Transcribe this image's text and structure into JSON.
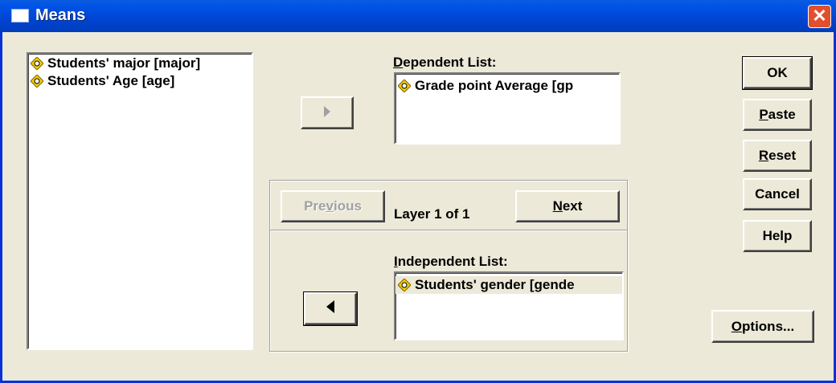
{
  "window": {
    "title": "Means",
    "close_glyph": "✕"
  },
  "source_list": {
    "items": [
      {
        "label": "Students' major [major]",
        "icon": "scale-variable-icon"
      },
      {
        "label": "Students' Age [age]",
        "icon": "scale-variable-icon"
      }
    ]
  },
  "dependent": {
    "label_prefix": "",
    "label_accel": "D",
    "label_rest": "ependent List:",
    "items": [
      {
        "label": "Grade point Average [gp",
        "icon": "scale-variable-icon"
      }
    ]
  },
  "layer": {
    "previous_pre": "Pre",
    "previous_accel": "v",
    "previous_post": "ious",
    "text": "Layer 1 of 1",
    "next_accel": "N",
    "next_post": "ext"
  },
  "independent": {
    "label_accel": "I",
    "label_rest": "ndependent List:",
    "items": [
      {
        "label": "Students' gender [gende",
        "icon": "scale-variable-icon"
      }
    ]
  },
  "buttons": {
    "ok": "OK",
    "paste_accel": "P",
    "paste_rest": "aste",
    "reset_accel": "R",
    "reset_rest": "eset",
    "cancel": "Cancel",
    "help": "Help",
    "options_accel": "O",
    "options_rest": "ptions..."
  },
  "colors": {
    "titlebar": "#0054e3",
    "dialog": "#ece9d8",
    "close": "#e0502e"
  }
}
